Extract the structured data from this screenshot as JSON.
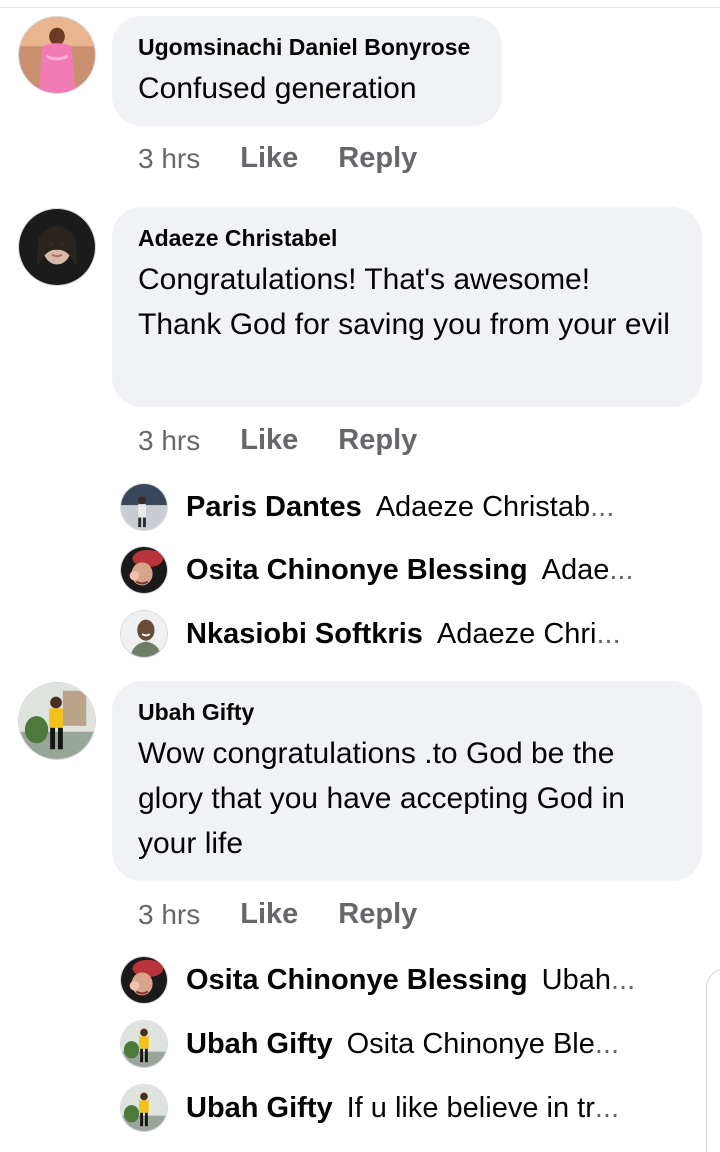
{
  "comments": [
    {
      "author": "Ugomsinachi Daniel Bonyrose",
      "avatar": "pink-dress-avatar",
      "text": "Confused generation",
      "time": "3 hrs",
      "like": "Like",
      "reply": "Reply"
    },
    {
      "author": "Adaeze Christabel",
      "avatar": "woman-portrait-avatar",
      "text": "Congratulations! That's awesome! Thank God for saving you from your evil",
      "time": "3 hrs",
      "like": "Like",
      "reply": "Reply",
      "replies": [
        {
          "name": "Paris Dantes",
          "text": "Adaeze Christab",
          "ellipsis": "...",
          "avatar": "standing-man-avatar"
        },
        {
          "name": "Osita Chinonye Blessing",
          "text": "Adae",
          "ellipsis": "...",
          "avatar": "red-hat-avatar"
        },
        {
          "name": "Nkasiobi Softkris",
          "text": "Adaeze Chri",
          "ellipsis": "...",
          "avatar": "smiling-man-avatar"
        }
      ]
    },
    {
      "author": "Ubah Gifty",
      "avatar": "yellow-shirt-avatar",
      "text": "Wow congratulations .to God be the glory that you have accepting God in your life",
      "time": "3 hrs",
      "like": "Like",
      "reply": "Reply",
      "replies": [
        {
          "name": "Osita Chinonye Blessing",
          "text": "Ubah",
          "ellipsis": "...",
          "avatar": "red-hat-avatar"
        },
        {
          "name": "Ubah Gifty",
          "text": "Osita Chinonye Ble",
          "ellipsis": "...",
          "avatar": "yellow-shirt-avatar"
        },
        {
          "name": "Ubah Gifty",
          "text": "If u like believe in tr",
          "ellipsis": "...",
          "avatar": "yellow-shirt-avatar"
        }
      ]
    }
  ],
  "colors": {
    "bubble": "#f0f2f5",
    "meta_text": "#65676b",
    "primary_text": "#050505"
  }
}
